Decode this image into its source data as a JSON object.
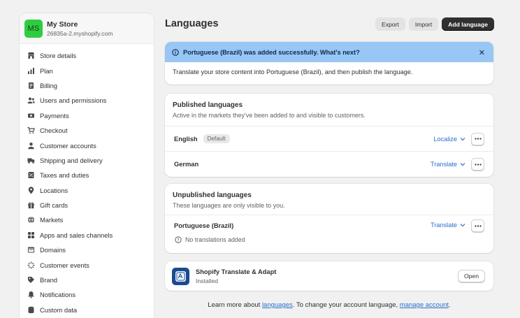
{
  "store": {
    "initials": "MS",
    "name": "My Store",
    "domain": "26835a-2.myshopify.com"
  },
  "sidebar": {
    "items": [
      {
        "label": "Store details",
        "icon": "store-icon"
      },
      {
        "label": "Plan",
        "icon": "plan-icon"
      },
      {
        "label": "Billing",
        "icon": "billing-icon"
      },
      {
        "label": "Users and permissions",
        "icon": "users-icon"
      },
      {
        "label": "Payments",
        "icon": "payments-icon"
      },
      {
        "label": "Checkout",
        "icon": "cart-icon"
      },
      {
        "label": "Customer accounts",
        "icon": "person-icon"
      },
      {
        "label": "Shipping and delivery",
        "icon": "truck-icon"
      },
      {
        "label": "Taxes and duties",
        "icon": "taxes-icon"
      },
      {
        "label": "Locations",
        "icon": "location-icon"
      },
      {
        "label": "Gift cards",
        "icon": "gift-icon"
      },
      {
        "label": "Markets",
        "icon": "globe-icon"
      },
      {
        "label": "Apps and sales channels",
        "icon": "apps-icon"
      },
      {
        "label": "Domains",
        "icon": "domains-icon"
      },
      {
        "label": "Customer events",
        "icon": "events-icon"
      },
      {
        "label": "Brand",
        "icon": "brand-icon"
      },
      {
        "label": "Notifications",
        "icon": "bell-icon"
      },
      {
        "label": "Custom data",
        "icon": "data-icon"
      }
    ]
  },
  "header": {
    "title": "Languages",
    "export_label": "Export",
    "import_label": "Import",
    "add_label": "Add language"
  },
  "banner": {
    "title": "Portuguese (Brazil) was added successfully. What's next?",
    "body": "Translate your store content into Portuguese (Brazil), and then publish the language."
  },
  "published": {
    "title": "Published languages",
    "subtitle": "Active in the markets they've been added to and visible to customers.",
    "rows": [
      {
        "name": "English",
        "badge": "Default",
        "action": "Localize"
      },
      {
        "name": "German",
        "action": "Translate"
      }
    ]
  },
  "unpublished": {
    "title": "Unpublished languages",
    "subtitle": "These languages are only visible to you.",
    "row": {
      "name": "Portuguese (Brazil)",
      "action": "Translate",
      "notice": "No translations added"
    }
  },
  "app": {
    "name": "Shopify Translate & Adapt",
    "status": "Installed",
    "open_label": "Open"
  },
  "footer": {
    "prefix": "Learn more about ",
    "link1": "languages",
    "middle": ". To change your account language, ",
    "link2": "manage account",
    "suffix": "."
  },
  "colors": {
    "accent_link": "#2c6ecb",
    "banner_bg": "#98c6f5",
    "avatar_bg": "#2ecc40",
    "primary_button": "#303030"
  }
}
